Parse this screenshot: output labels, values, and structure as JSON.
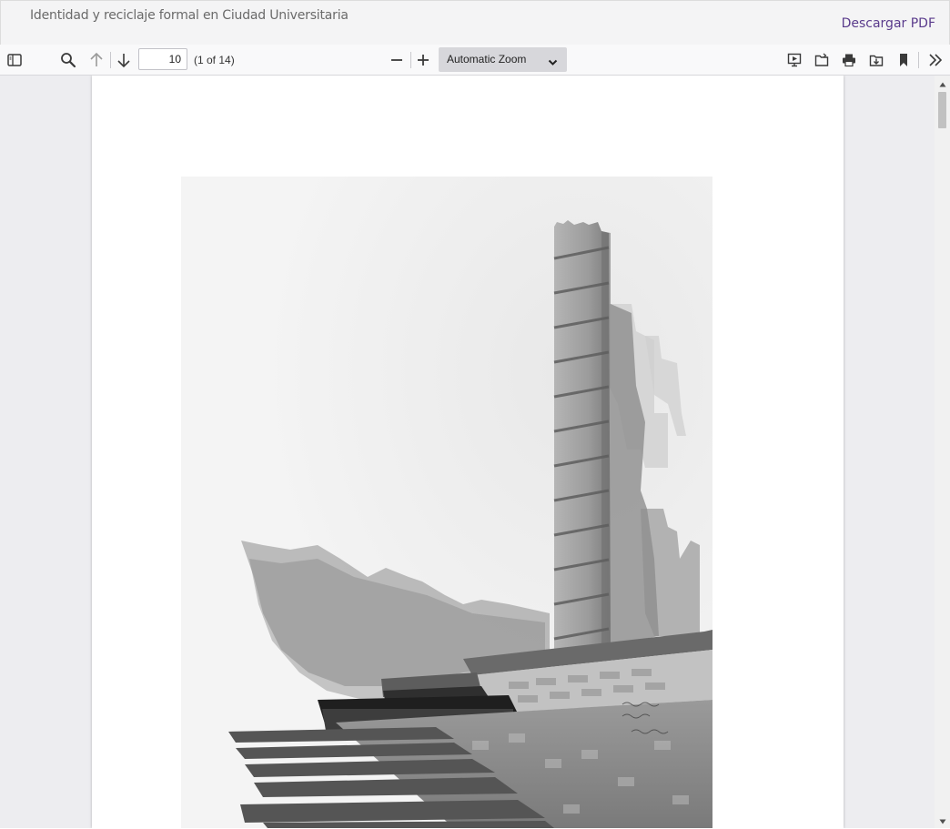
{
  "header": {
    "title": "Identidad y reciclaje formal en Ciudad Universitaria",
    "download_label": "Descargar PDF"
  },
  "toolbar": {
    "page_value": "10",
    "page_count": "(1 of 14)",
    "zoom_label": "Automatic Zoom",
    "icons": [
      "sidebar-toggle-icon",
      "search-icon",
      "arrow-up-icon",
      "arrow-down-icon",
      "zoom-out-icon",
      "zoom-in-icon",
      "presentation-icon",
      "open-file-icon",
      "print-icon",
      "save-icon",
      "bookmark-icon",
      "double-chevron-right-icon"
    ]
  },
  "document": {
    "current_page": 10,
    "total_pages": 14,
    "page_content": "watercolor-sketch-of-tower-building"
  },
  "colors": {
    "link": "#5a3b8c",
    "toolbar_bg": "#f9f9fa",
    "viewer_bg": "#ededf0"
  }
}
